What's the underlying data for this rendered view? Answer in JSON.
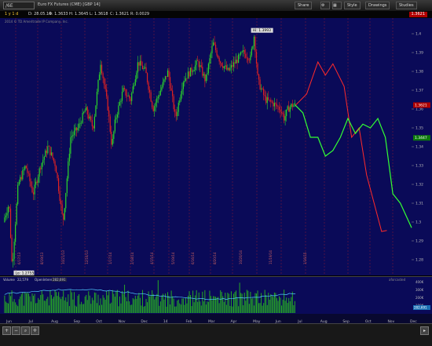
{
  "toolbar": {
    "symbol": "/6E",
    "description": "Euro FX Futures (CME) [GBP 14]",
    "buttons": [
      "Share",
      "Style",
      "Drawings",
      "Studies"
    ]
  },
  "info": {
    "timeframe": "1 y 1 d",
    "date": "D: 28.05.14",
    "open": "O: 1.3633",
    "high": "H: 1.3645",
    "low": "L: 1.3618",
    "close": "C: 1.3621",
    "range": "R: 0.0029",
    "last_price": "1.3621"
  },
  "copyright": "2014 © TD Ameritrade IP Company, Inc.",
  "price_scale": {
    "ticks": [
      "1.4",
      "1.39",
      "1.38",
      "1.37",
      "1.36",
      "1.35",
      "1.34",
      "1.33",
      "1.32",
      "1.31",
      "1.3",
      "1.29",
      "1.28"
    ],
    "current_price_label": "1.3621",
    "projection_label": "1.3447"
  },
  "high_label": "Hi: 1.3993",
  "low_label": "Lo: 1.2755",
  "date_annotations": [
    "6/17/13",
    "8/19/13",
    "10/21/13",
    "12/16/13",
    "1/17/14",
    "2/18/14",
    "4/15/14",
    "5/19/14",
    "6/16/14",
    "8/20/14",
    "10/20/14",
    "11/19/14",
    "1/16/15"
  ],
  "volume_panel": {
    "label": "Volume",
    "value": "22,579",
    "oi_label": "OpenInterest",
    "oi_value": "282,691",
    "corner_label": "aforcasted",
    "scale_ticks": [
      "400K",
      "300K",
      "200K",
      "100K"
    ],
    "current_label": "282,691"
  },
  "time_axis": [
    "Jun",
    "Jul",
    "Aug",
    "Sep",
    "Oct",
    "Nov",
    "Dec",
    "14",
    "Feb",
    "Mar",
    "Apr",
    "May",
    "Jun",
    "Jul",
    "Aug",
    "Sep",
    "Oct",
    "Nov",
    "Dec"
  ],
  "colors": {
    "background": "#0a0a58",
    "up": "#2bd42b",
    "down": "#e02222",
    "grid": "#7a1a3a",
    "projection_red": "#ff2a2a",
    "projection_green": "#33ff33",
    "volume_bar": "#26a826",
    "open_interest": "#4fc8ff"
  },
  "chart_data": {
    "type": "candlestick",
    "title": "",
    "y_range": [
      1.275,
      1.405
    ],
    "price_path": [
      [
        0,
        1.3
      ],
      [
        8,
        1.31
      ],
      [
        12,
        1.2755
      ],
      [
        20,
        1.32
      ],
      [
        30,
        1.33
      ],
      [
        40,
        1.315
      ],
      [
        50,
        1.33
      ],
      [
        60,
        1.34
      ],
      [
        70,
        1.33
      ],
      [
        80,
        1.3
      ],
      [
        90,
        1.345
      ],
      [
        100,
        1.35
      ],
      [
        110,
        1.36
      ],
      [
        120,
        1.35
      ],
      [
        130,
        1.385
      ],
      [
        140,
        1.36
      ],
      [
        145,
        1.34
      ],
      [
        150,
        1.355
      ],
      [
        160,
        1.37
      ],
      [
        170,
        1.365
      ],
      [
        180,
        1.385
      ],
      [
        190,
        1.38
      ],
      [
        200,
        1.36
      ],
      [
        210,
        1.37
      ],
      [
        220,
        1.38
      ],
      [
        230,
        1.355
      ],
      [
        240,
        1.375
      ],
      [
        250,
        1.38
      ],
      [
        260,
        1.385
      ],
      [
        270,
        1.375
      ],
      [
        280,
        1.395
      ],
      [
        290,
        1.385
      ],
      [
        300,
        1.38
      ],
      [
        310,
        1.385
      ],
      [
        320,
        1.39
      ],
      [
        330,
        1.387
      ],
      [
        335,
        1.3993
      ],
      [
        340,
        1.375
      ],
      [
        350,
        1.365
      ],
      [
        360,
        1.363
      ],
      [
        370,
        1.36
      ],
      [
        375,
        1.355
      ],
      [
        380,
        1.36
      ],
      [
        385,
        1.362
      ],
      [
        390,
        1.3621
      ]
    ],
    "projection_red": [
      [
        390,
        1.362
      ],
      [
        405,
        1.368
      ],
      [
        420,
        1.385
      ],
      [
        430,
        1.378
      ],
      [
        440,
        1.384
      ],
      [
        455,
        1.372
      ],
      [
        465,
        1.345
      ],
      [
        475,
        1.35
      ],
      [
        485,
        1.325
      ],
      [
        495,
        1.31
      ],
      [
        505,
        1.295
      ],
      [
        512,
        1.2955
      ]
    ],
    "projection_green": [
      [
        390,
        1.362
      ],
      [
        400,
        1.358
      ],
      [
        410,
        1.345
      ],
      [
        420,
        1.345
      ],
      [
        430,
        1.335
      ],
      [
        440,
        1.338
      ],
      [
        450,
        1.345
      ],
      [
        460,
        1.355
      ],
      [
        470,
        1.347
      ],
      [
        480,
        1.352
      ],
      [
        490,
        1.35
      ],
      [
        500,
        1.355
      ],
      [
        510,
        1.345
      ],
      [
        520,
        1.315
      ],
      [
        530,
        1.31
      ],
      [
        545,
        1.297
      ]
    ]
  }
}
